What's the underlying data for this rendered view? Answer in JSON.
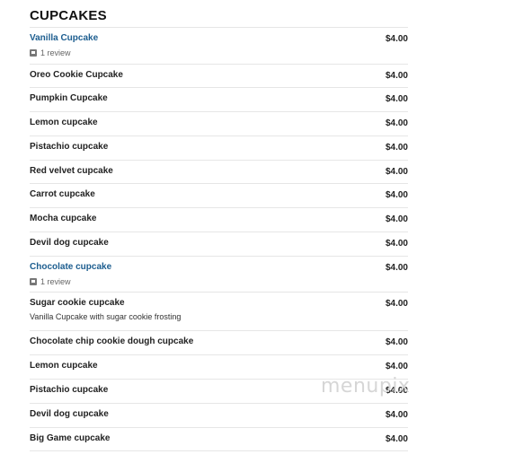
{
  "section": {
    "title": "CUPCAKES"
  },
  "items": [
    {
      "name": "Vanilla Cupcake",
      "price": "$4.00",
      "link": true,
      "review": "1 review"
    },
    {
      "name": "Oreo Cookie Cupcake",
      "price": "$4.00"
    },
    {
      "name": "Pumpkin Cupcake",
      "price": "$4.00"
    },
    {
      "name": "Lemon cupcake",
      "price": "$4.00"
    },
    {
      "name": "Pistachio cupcake",
      "price": "$4.00"
    },
    {
      "name": "Red velvet cupcake",
      "price": "$4.00"
    },
    {
      "name": "Carrot cupcake",
      "price": "$4.00"
    },
    {
      "name": "Mocha cupcake",
      "price": "$4.00"
    },
    {
      "name": "Devil dog cupcake",
      "price": "$4.00"
    },
    {
      "name": "Chocolate cupcake",
      "price": "$4.00",
      "link": true,
      "review": "1 review"
    },
    {
      "name": "Sugar cookie cupcake",
      "price": "$4.00",
      "description": "Vanilla Cupcake with sugar cookie frosting"
    },
    {
      "name": "Chocolate chip cookie dough cupcake",
      "price": "$4.00"
    },
    {
      "name": "Lemon cupcake",
      "price": "$4.00"
    },
    {
      "name": "Pistachio cupcake",
      "price": "$4.00"
    },
    {
      "name": "Devil dog cupcake",
      "price": "$4.00"
    },
    {
      "name": "Big Game cupcake",
      "price": "$4.00"
    }
  ],
  "watermark": "menupix",
  "colors": {
    "link": "#1c5d8f",
    "divider": "#e6e6e6",
    "text": "#222222"
  },
  "icons": {
    "review": "review-icon"
  }
}
